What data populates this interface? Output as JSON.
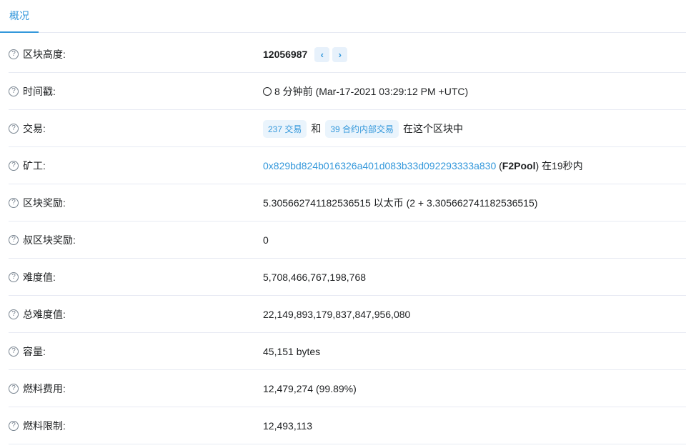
{
  "tab": "概况",
  "rows": [
    {
      "label": "区块高度:"
    },
    {
      "label": "时间戳:"
    },
    {
      "label": "交易:"
    },
    {
      "label": "矿工:"
    },
    {
      "label": "区块奖励:"
    },
    {
      "label": "叔区块奖励:"
    },
    {
      "label": "难度值:"
    },
    {
      "label": "总难度值:"
    },
    {
      "label": "容量:"
    },
    {
      "label": "燃料费用:"
    },
    {
      "label": "燃料限制:"
    }
  ],
  "block_height": "12056987",
  "prev": "‹",
  "next": "›",
  "timestamp": "8 分钟前 (Mar-17-2021 03:29:12 PM +UTC)",
  "tx_badge": "237 交易",
  "and": "和",
  "internal_badge": "39 合约内部交易",
  "in_block": "在这个区块中",
  "miner_address": "0x829bd824b016326a401d083b33d092293333a830",
  "miner_name": "F2Pool",
  "miner_time": "在19秒内",
  "block_reward": "5.305662741182536515 以太币 (2 + 3.305662741182536515)",
  "uncle_reward": "0",
  "difficulty": "5,708,466,767,198,768",
  "total_difficulty": "22,149,893,179,837,847,956,080",
  "size": "45,151 bytes",
  "gas_used": "12,479,274 (99.89%)",
  "gas_limit": "12,493,113"
}
